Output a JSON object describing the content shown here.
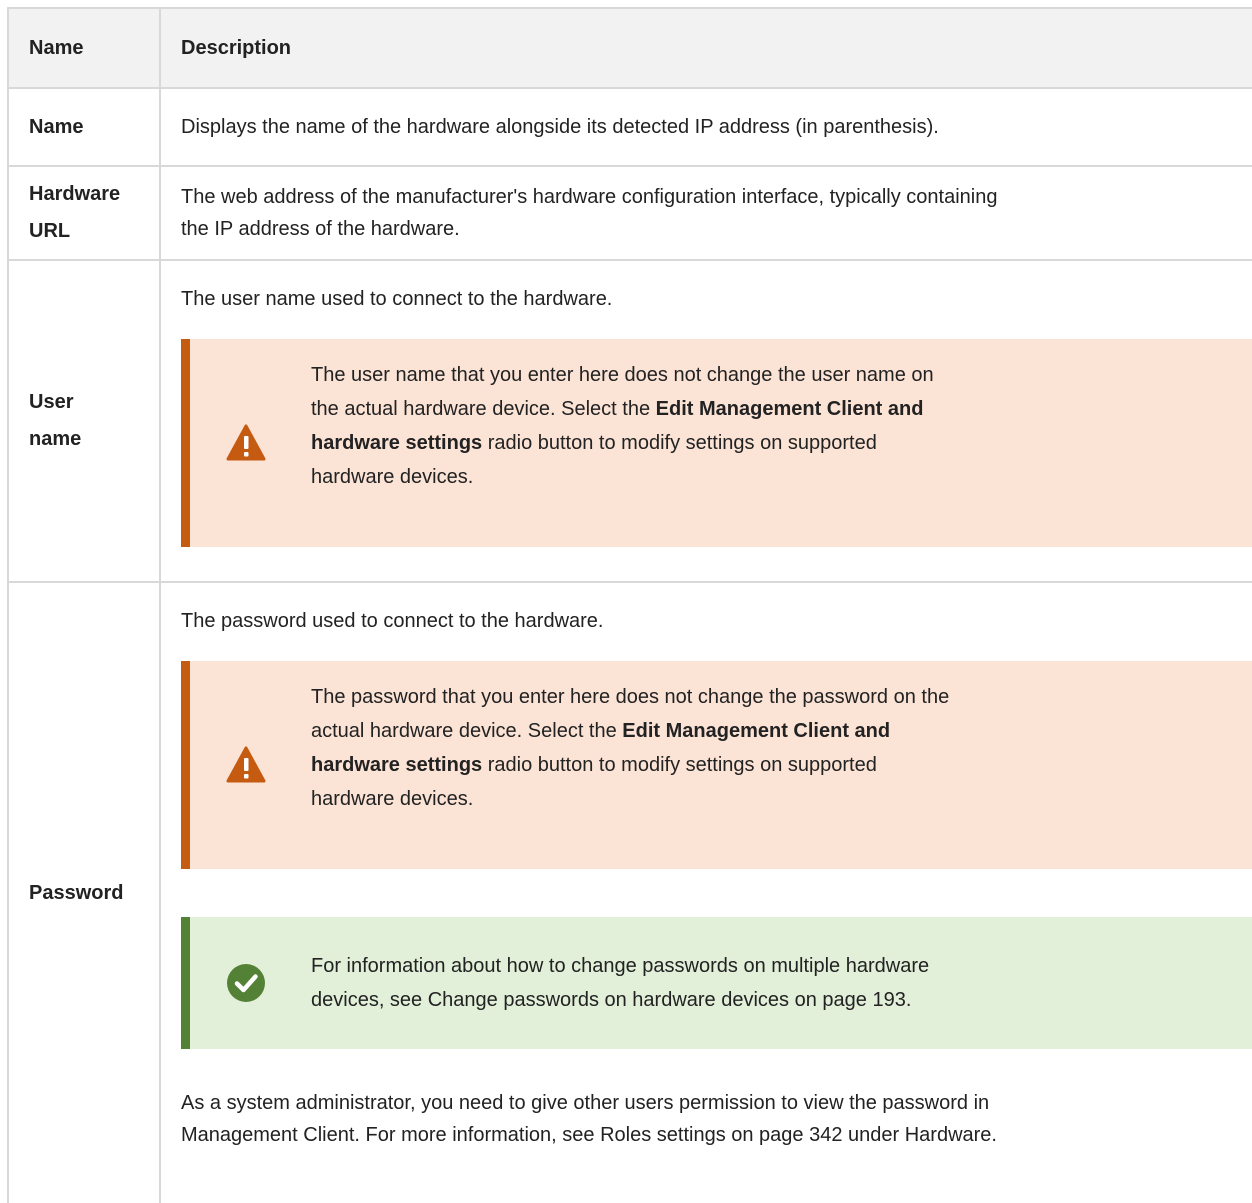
{
  "table": {
    "headers": {
      "name": "Name",
      "description": "Description"
    },
    "rows": [
      {
        "name": "Name",
        "description": "Displays the name of the hardware alongside its detected IP address (in parenthesis)."
      },
      {
        "name_line1": "Hardware",
        "name_line2": "URL",
        "description_line1": "The web address of the manufacturer's hardware configuration interface, typically containing",
        "description_line2": "the IP address of the hardware."
      },
      {
        "name_line1": "User",
        "name_line2": "name",
        "description": "The user name used to connect to the hardware.",
        "warning": {
          "icon": "warning-triangle-icon",
          "line1": "The user name that you enter here does not change the user name on",
          "line2_pre": "the actual hardware device. Select the ",
          "line2_bold": "Edit Management Client and",
          "line3_bold": "hardware settings",
          "line3_post": " radio button to modify settings on supported",
          "line4": "hardware devices."
        }
      },
      {
        "name": "Password",
        "description": "The password used to connect to the hardware.",
        "warning": {
          "icon": "warning-triangle-icon",
          "line1": "The password that you enter here does not change the password on the",
          "line2_pre": "actual hardware device. Select the ",
          "line2_bold": "Edit Management Client and",
          "line3_bold": "hardware settings",
          "line3_post": " radio button to modify settings on supported",
          "line4": "hardware devices."
        },
        "tip": {
          "icon": "checkmark-circle-icon",
          "line1": "For information about how to change passwords on multiple hardware",
          "line2": "devices, see Change passwords on hardware devices on page 193."
        },
        "footer_line1": "As a system administrator, you need to give other users permission to view the password in",
        "footer_line2": "Management Client. For more information, see Roles settings on page 342 under Hardware."
      }
    ]
  },
  "colors": {
    "warning_bar": "#c55a11",
    "warning_bg": "#fbe3d6",
    "tip_bar": "#538135",
    "tip_bg": "#e2efd9"
  }
}
